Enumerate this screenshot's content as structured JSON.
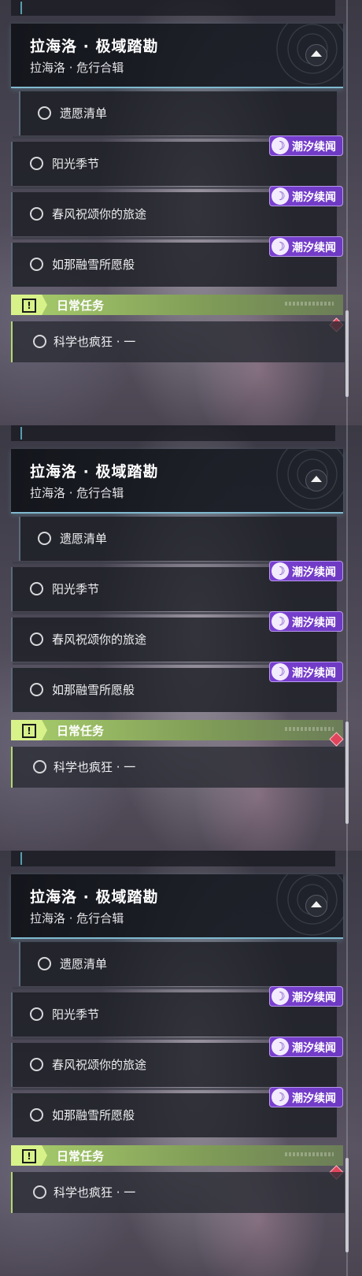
{
  "colors": {
    "badge_purple": "#7a3fd0",
    "daily_green": "#a9cf6c",
    "header_underline": "#7fb9cf",
    "alert_red": "#e0455c"
  },
  "panels": [
    {
      "header": {
        "title": "拉海洛 · 极域踏勘",
        "subtitle": "拉海洛 · 危行合辑",
        "collapse_icon": "chevron-up-icon"
      },
      "quests": [
        {
          "label": "遗愿清单",
          "badge": ""
        },
        {
          "label": "阳光季节",
          "badge": "潮汐续闻"
        },
        {
          "label": "春风祝颂你的旅途",
          "badge": "潮汐续闻"
        },
        {
          "label": "如那融雪所愿般",
          "badge": "潮汐续闻"
        }
      ],
      "daily": {
        "title": "日常任务",
        "icon": "exclamation-icon",
        "quest": "科学也疯狂 · 一"
      }
    },
    {
      "header": {
        "title": "拉海洛 · 极域踏勘",
        "subtitle": "拉海洛 · 危行合辑",
        "collapse_icon": "chevron-up-icon"
      },
      "quests": [
        {
          "label": "遗愿清单",
          "badge": ""
        },
        {
          "label": "阳光季节",
          "badge": "潮汐续闻"
        },
        {
          "label": "春风祝颂你的旅途",
          "badge": "潮汐续闻"
        },
        {
          "label": "如那融雪所愿般",
          "badge": "潮汐续闻"
        }
      ],
      "daily": {
        "title": "日常任务",
        "icon": "exclamation-icon",
        "quest": "科学也疯狂 · 一"
      }
    },
    {
      "header": {
        "title": "拉海洛 · 极域踏勘",
        "subtitle": "拉海洛 · 危行合辑",
        "collapse_icon": "chevron-up-icon"
      },
      "quests": [
        {
          "label": "遗愿清单",
          "badge": ""
        },
        {
          "label": "阳光季节",
          "badge": "潮汐续闻"
        },
        {
          "label": "春风祝颂你的旅途",
          "badge": "潮汐续闻"
        },
        {
          "label": "如那融雪所愿般",
          "badge": "潮汐续闻"
        }
      ],
      "daily": {
        "title": "日常任务",
        "icon": "exclamation-icon",
        "quest": "科学也疯狂 · 一"
      }
    }
  ]
}
